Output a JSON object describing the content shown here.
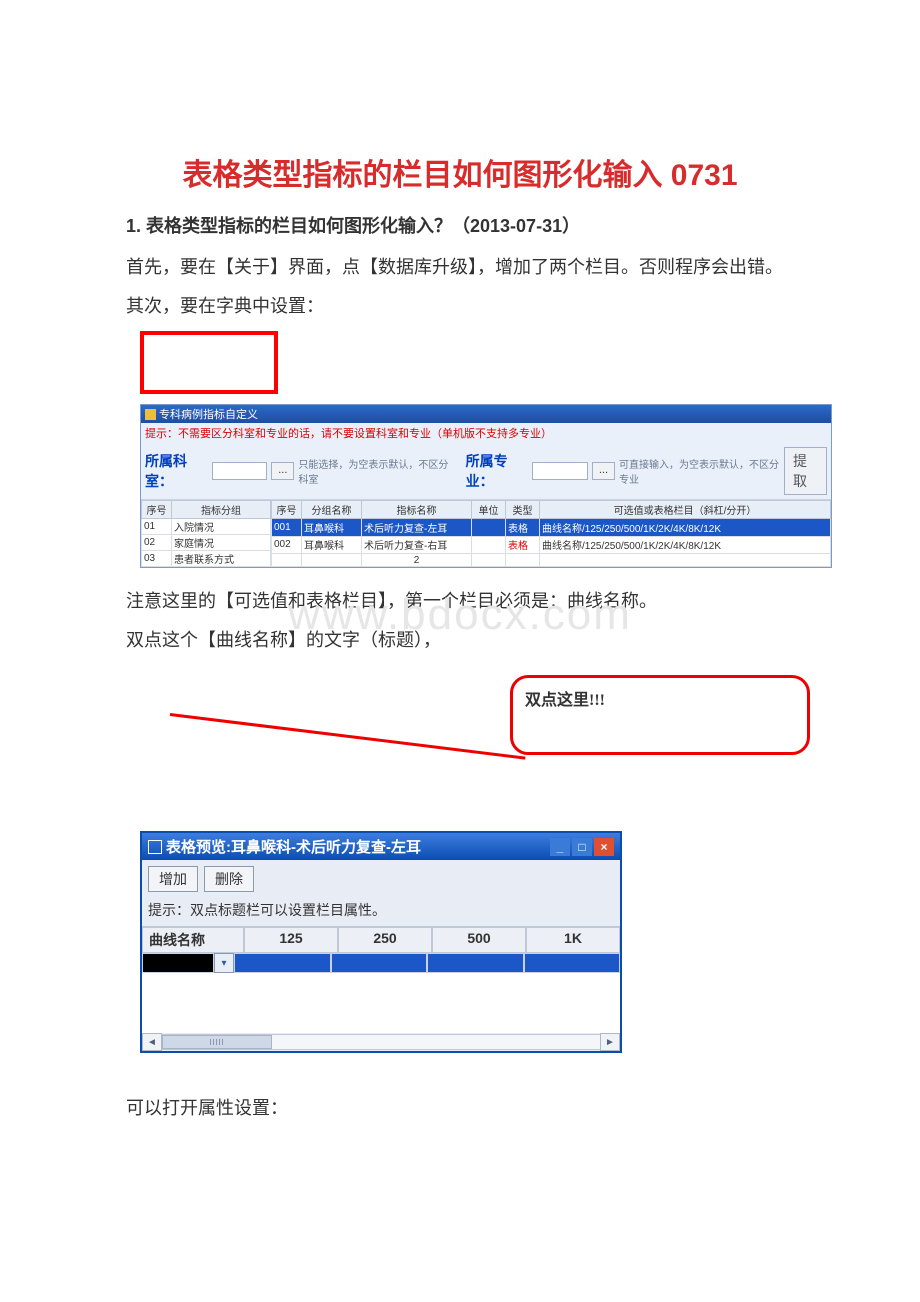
{
  "title": "表格类型指标的栏目如何图形化输入 0731",
  "h2": "1. 表格类型指标的栏目如何图形化输入？（2013-07-31）",
  "p1": "首先，要在【关于】界面，点【数据库升级】，增加了两个栏目。否则程序会出错。",
  "p2": "其次，要在字典中设置：",
  "p3": "注意这里的【可选值和表格栏目】，第一个栏目必须是：曲线名称。",
  "p4": "双点这个【曲线名称】的文字（标题），",
  "p5": "可以打开属性设置：",
  "callout": "双点这里!!!",
  "watermark": "www.bdocx.com",
  "win1": {
    "title": "专科病例指标自定义",
    "hint": "提示：不需要区分科室和专业的话，请不要设置科室和专业（单机版不支持多专业）",
    "lbl_dept": "所属科室：",
    "lbl_major": "所属专业：",
    "dots": "...",
    "hint_dept": "只能选择，为空表示默认，不区分科室",
    "hint_major": "可直接输入，为空表示默认，不区分专业",
    "btn_extract": "提取",
    "left_head": [
      "序号",
      "指标分组"
    ],
    "left_rows": [
      [
        "01",
        "入院情况"
      ],
      [
        "02",
        "家庭情况"
      ],
      [
        "03",
        "患者联系方式"
      ]
    ],
    "right_head": [
      "序号",
      "分组名称",
      "指标名称",
      "单位",
      "类型",
      "可选值或表格栏目（斜杠/分开）"
    ],
    "right_rows": [
      [
        "001",
        "耳鼻喉科",
        "术后听力复查-左耳",
        "",
        "表格",
        "曲线名称/125/250/500/1K/2K/4K/8K/12K"
      ],
      [
        "002",
        "耳鼻喉科",
        "术后听力复查-右耳",
        "",
        "表格",
        "曲线名称/125/250/500/1K/2K/4K/8K/12K"
      ]
    ],
    "foot": "2"
  },
  "win2": {
    "title": "表格预览:耳鼻喉科-术后听力复查-左耳",
    "btn_add": "增加",
    "btn_del": "删除",
    "tip": "提示：双点标题栏可以设置栏目属性。",
    "cols": [
      "曲线名称",
      "125",
      "250",
      "500",
      "1K"
    ]
  }
}
